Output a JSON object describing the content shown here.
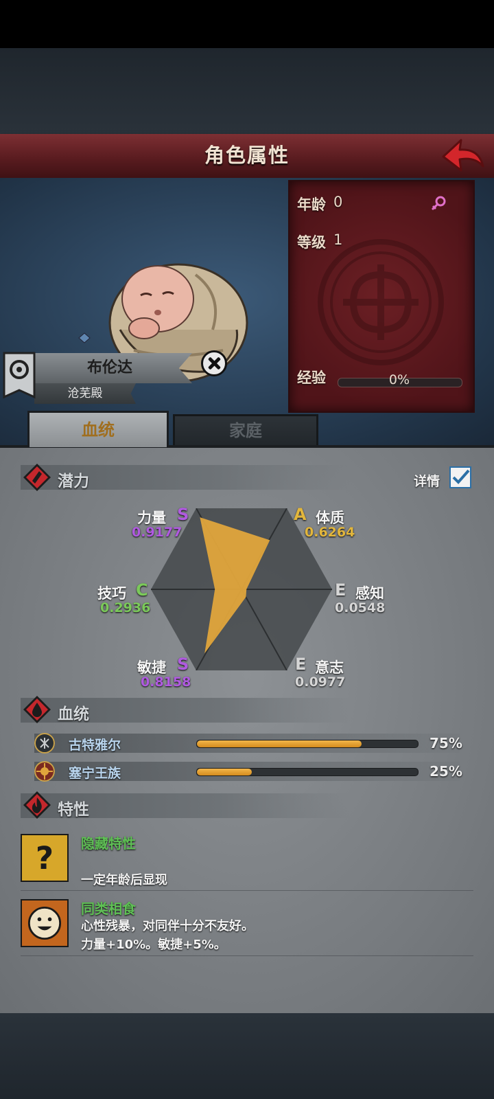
{
  "header": {
    "title": "角色属性",
    "back_icon": "back-arrow-icon"
  },
  "character": {
    "name": "布伦达",
    "house": "沧芜殿",
    "age_label": "年龄",
    "age_value": "0",
    "level_label": "等级",
    "level_value": "1",
    "gender_icon": "female-icon",
    "xp_label": "经验",
    "xp_value": "0%",
    "xp_fraction": 0
  },
  "tabs": {
    "lineage": "血统",
    "family": "家庭"
  },
  "potential": {
    "title": "潜力",
    "details_label": "详情",
    "details_checked": true,
    "stats": {
      "strength": {
        "name": "力量",
        "grade": "S",
        "value": "0.9177"
      },
      "constitution": {
        "name": "体质",
        "grade": "A",
        "value": "0.6264"
      },
      "perception": {
        "name": "感知",
        "grade": "E",
        "value": "0.0548"
      },
      "will": {
        "name": "意志",
        "grade": "E",
        "value": "0.0977"
      },
      "agility": {
        "name": "敏捷",
        "grade": "S",
        "value": "0.8158"
      },
      "skill": {
        "name": "技巧",
        "grade": "C",
        "value": "0.2936"
      }
    },
    "colors": {
      "S": "#b05ae0",
      "A": "#e2b63c",
      "C": "#7bc95a",
      "E": "#d6d6d6"
    }
  },
  "bloodline": {
    "title": "血统",
    "items": [
      {
        "name": "古特雅尔",
        "percent": "75%",
        "fraction": 0.75
      },
      {
        "name": "塞宁王族",
        "percent": "25%",
        "fraction": 0.25
      }
    ]
  },
  "traits": {
    "title": "特性",
    "items": [
      {
        "name": "隐藏特性",
        "desc1": "一定年龄后显现",
        "desc2": ""
      },
      {
        "name": "同类相食",
        "desc1": "心性残暴，对同伴十分不友好。",
        "desc2": "力量+10%。敏捷+5%。"
      }
    ]
  }
}
